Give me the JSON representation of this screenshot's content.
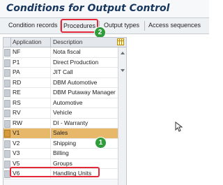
{
  "header": {
    "title": "Conditions for Output Control"
  },
  "toolbar": {
    "items": [
      {
        "label": "Condition records"
      },
      {
        "label": "Procedures"
      },
      {
        "label": "Output types"
      },
      {
        "label": "Access sequences"
      }
    ]
  },
  "table": {
    "columns": [
      "Application",
      "Description"
    ],
    "rows": [
      {
        "app": "NF",
        "desc": "Nota fiscal"
      },
      {
        "app": "P1",
        "desc": "Direct Production"
      },
      {
        "app": "PA",
        "desc": "JIT Call"
      },
      {
        "app": "RD",
        "desc": "DBM Automotive"
      },
      {
        "app": "RE",
        "desc": "DBM Putaway Manager"
      },
      {
        "app": "RS",
        "desc": "Automotive"
      },
      {
        "app": "RV",
        "desc": "Vehicle"
      },
      {
        "app": "RW",
        "desc": "DI - Warranty"
      },
      {
        "app": "V1",
        "desc": "Sales"
      },
      {
        "app": "V2",
        "desc": "Shipping"
      },
      {
        "app": "V3",
        "desc": "Billing"
      },
      {
        "app": "V5",
        "desc": "Groups"
      },
      {
        "app": "V6",
        "desc": "Handling Units"
      }
    ]
  },
  "annotations": {
    "step1": "1",
    "step2": "2"
  },
  "colors": {
    "highlight": "#e3283a",
    "selected_row": "#e8b86a",
    "badge": "#2f9d3a",
    "title": "#17365d"
  }
}
